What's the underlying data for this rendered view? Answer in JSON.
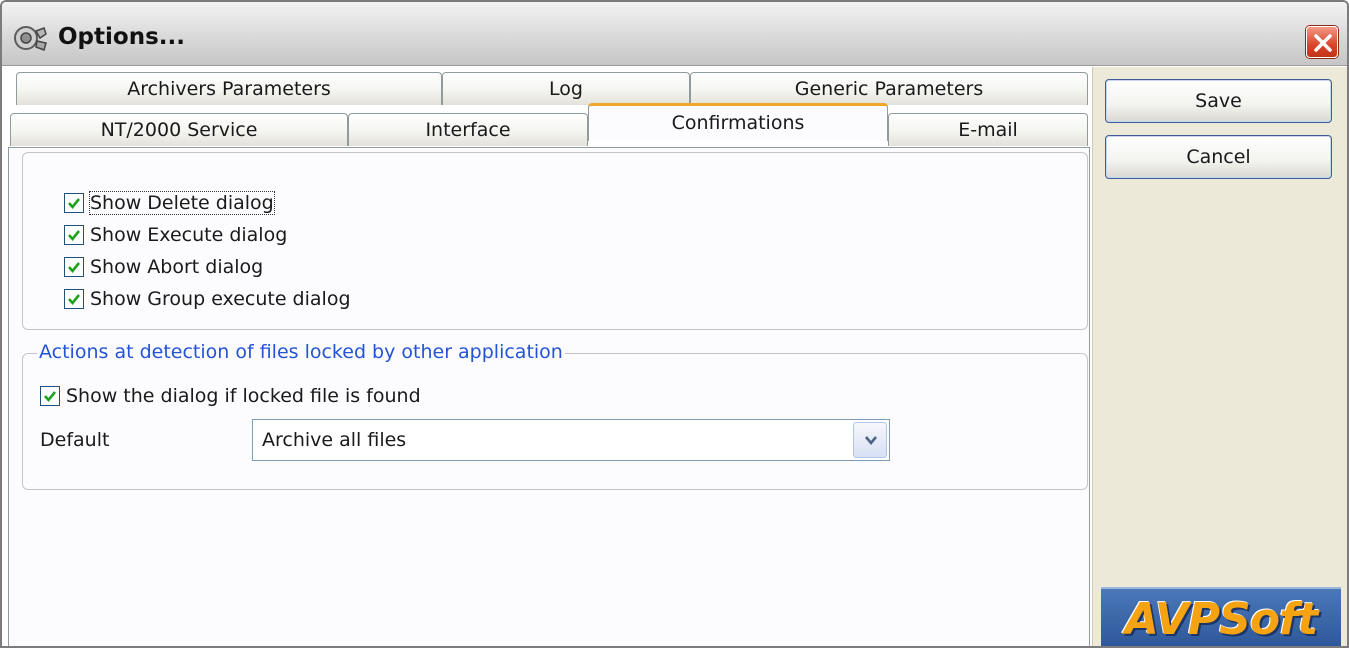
{
  "window": {
    "title": "Options...",
    "icon": "app-gear-icon",
    "close_icon": "close-icon"
  },
  "tabs": {
    "row1": [
      "Archivers Parameters",
      "Log",
      "Generic Parameters"
    ],
    "row2": [
      "NT/2000 Service",
      "Interface",
      "Confirmations",
      "E-mail"
    ],
    "selected": "Confirmations"
  },
  "confirmations": {
    "items": [
      {
        "label": "Show Delete dialog",
        "checked": true
      },
      {
        "label": "Show Execute dialog",
        "checked": true
      },
      {
        "label": "Show Abort dialog",
        "checked": true
      },
      {
        "label": "Show Group execute dialog",
        "checked": true
      }
    ]
  },
  "locked_files": {
    "legend": "Actions at detection of files locked by other application",
    "show_dialog": {
      "label": "Show the dialog if locked file is found",
      "checked": true
    },
    "default_label": "Default",
    "default_value": "Archive all files"
  },
  "sidebar": {
    "save_label": "Save",
    "cancel_label": "Cancel",
    "logo_text": "AVPSoft"
  },
  "colors": {
    "accent_tab": "#f0a629",
    "legend_text": "#2454d6",
    "close_button": "#d9452c",
    "logo_bg": "#2d5698",
    "logo_text": "#f5a313"
  }
}
